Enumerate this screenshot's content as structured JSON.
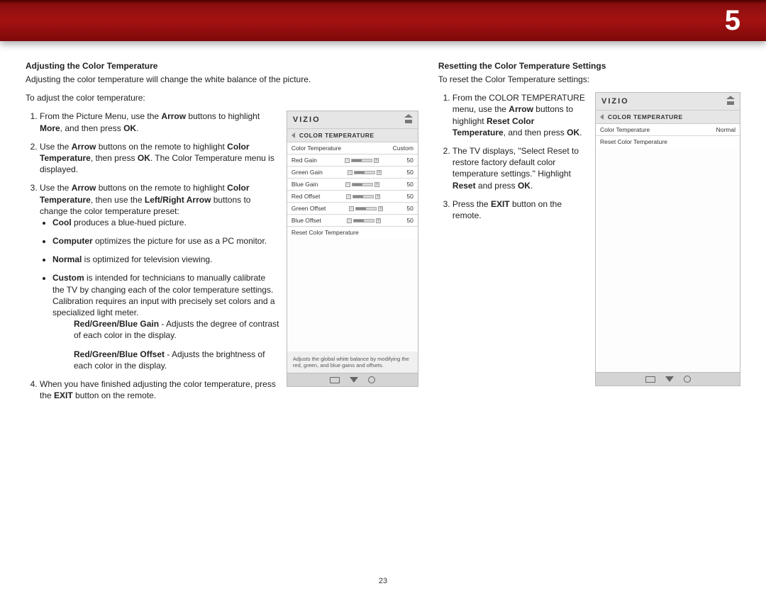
{
  "chapter_number": "5",
  "page_number": "23",
  "left": {
    "h2": "Adjusting the Color Temperature",
    "intro": "Adjusting the color temperature will change the white balance of the picture.",
    "lead": "To adjust the color temperature:",
    "s1_a": "From the Picture Menu, use the ",
    "s1_b": "Arrow",
    "s1_c": " buttons to highlight ",
    "s1_d": "More",
    "s1_e": ", and then press ",
    "s1_f": "OK",
    "s1_g": ".",
    "s2_a": "Use the ",
    "s2_b": "Arrow",
    "s2_c": " buttons on the remote to highlight ",
    "s2_d": "Color Temperature",
    "s2_e": ", then press ",
    "s2_f": "OK",
    "s2_g": ". The Color Temperature menu is displayed.",
    "s3_a": "Use the ",
    "s3_b": "Arrow",
    "s3_c": " buttons on the remote to highlight ",
    "s3_d": "Color Temperature",
    "s3_e": ", then use the ",
    "s3_f": "Left/Right Arrow",
    "s3_g": " buttons to change the color temperature preset:",
    "b1_a": "Cool",
    "b1_b": " produces a blue-hued picture.",
    "b2_a": "Computer",
    "b2_b": " optimizes the picture for use as a PC monitor.",
    "b3_a": "Normal",
    "b3_b": " is optimized for television viewing.",
    "b4_a": "Custom",
    "b4_b": " is intended for technicians to manually calibrate the TV by changing each of the color temperature settings. Calibration requires an input with precisely set colors and a specialized light meter.",
    "g_a": "Red/Green/Blue Gain",
    "g_b": " - Adjusts the degree of contrast of each color in the display.",
    "o_a": "Red/Green/Blue Offset",
    "o_b": " - Adjusts the brightness of each color in the display.",
    "s4_a": "When you have finished adjusting the color temperature, press the ",
    "s4_b": "EXIT",
    "s4_c": " button on the remote."
  },
  "right": {
    "h2": "Resetting the Color Temperature Settings",
    "intro": "To reset the Color Temperature settings:",
    "s1_a": "From the COLOR TEMPERATURE menu, use the ",
    "s1_b": "Arrow",
    "s1_c": " buttons to highlight ",
    "s1_d": "Reset Color Temperature",
    "s1_e": ", and then press ",
    "s1_f": "OK",
    "s1_g": ".",
    "s2_a": "The TV displays, \"Select Reset to restore factory default color temperature settings.\" Highlight ",
    "s2_b": "Reset",
    "s2_c": " and press ",
    "s2_d": "OK",
    "s2_e": ".",
    "s3_a": "Press the ",
    "s3_b": "EXIT",
    "s3_c": " button on the remote."
  },
  "shot1": {
    "brand": "VIZIO",
    "title": "COLOR TEMPERATURE",
    "rows": {
      "r0": {
        "label": "Color Temperature",
        "value": "Custom"
      },
      "r1": {
        "label": "Red Gain",
        "value": "50"
      },
      "r2": {
        "label": "Green Gain",
        "value": "50"
      },
      "r3": {
        "label": "Blue Gain",
        "value": "50"
      },
      "r4": {
        "label": "Red Offset",
        "value": "50"
      },
      "r5": {
        "label": "Green Offset",
        "value": "50"
      },
      "r6": {
        "label": "Blue Offset",
        "value": "50"
      },
      "r7": {
        "label": "Reset Color Temperature"
      }
    },
    "help": "Adjusts the global white balance by modifying the red, green, and blue gains and offsets."
  },
  "shot2": {
    "brand": "VIZIO",
    "title": "COLOR TEMPERATURE",
    "rows": {
      "r0": {
        "label": "Color Temperature",
        "value": "Normal"
      },
      "r1": {
        "label": "Reset Color Temperature"
      }
    }
  }
}
